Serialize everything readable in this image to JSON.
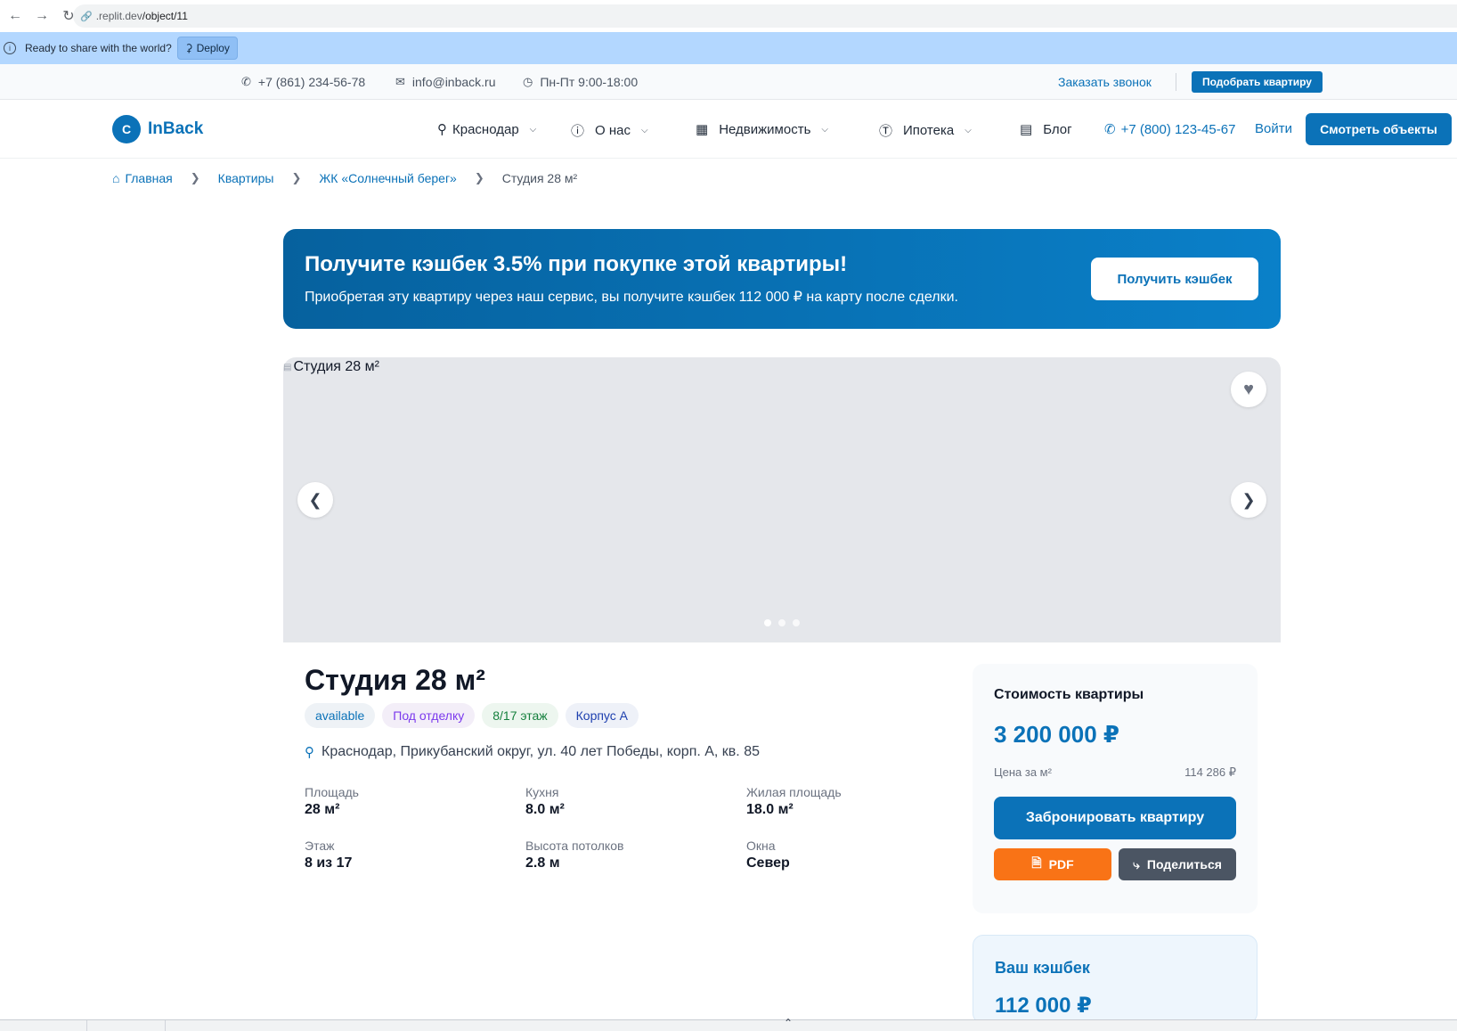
{
  "browser": {
    "url_host": ".replit.dev",
    "url_path": "/object/11"
  },
  "deploy_bar": {
    "message": "Ready to share with the world?",
    "button_label": "Deploy"
  },
  "topbar": {
    "phone": "+7 (861) 234-56-78",
    "email": "info@inback.ru",
    "hours": "Пн-Пт 9:00-18:00",
    "callback_link": "Заказать звонок",
    "pick_button": "Подобрать квартиру"
  },
  "nav": {
    "logo_letter": "С",
    "logo_text": "InBack",
    "city": "Краснодар",
    "about": "О нас",
    "realty": "Недвижимость",
    "mortgage": "Ипотека",
    "blog": "Блог",
    "phone": "+7 (800) 123-45-67",
    "login": "Войти",
    "cta": "Смотреть объекты"
  },
  "breadcrumb": {
    "home": "Главная",
    "apartments": "Квартиры",
    "complex": "ЖК «Солнечный берег»",
    "current": "Студия 28 м²"
  },
  "banner": {
    "title": "Получите кэшбек 3.5% при покупке этой квартиры!",
    "description": "Приобретая эту квартиру через наш сервис, вы получите кэшбек 112 000 ₽ на карту после сделки.",
    "button": "Получить кэшбек"
  },
  "gallery": {
    "image_alt": "Студия 28 м²",
    "dots_count": 3,
    "active_dot": 0
  },
  "object": {
    "title": "Студия 28 м²",
    "tags": [
      "available",
      "Под отделку",
      "8/17 этаж",
      "Корпус А"
    ],
    "address": "Краснодар, Прикубанский округ, ул. 40 лет Победы, корп. А, кв. 85",
    "specs": [
      {
        "label": "Площадь",
        "value": "28 м²"
      },
      {
        "label": "Кухня",
        "value": "8.0 м²"
      },
      {
        "label": "Жилая площадь",
        "value": "18.0 м²"
      },
      {
        "label": "Этаж",
        "value": "8 из 17"
      },
      {
        "label": "Высота потолков",
        "value": "2.8 м"
      },
      {
        "label": "Окна",
        "value": "Север"
      }
    ]
  },
  "price_card": {
    "title": "Стоимость квартиры",
    "price": "3 200 000 ₽",
    "per_sqm_label": "Цена за м²",
    "per_sqm_value": "114 286 ₽",
    "book_button": "Забронировать квартиру",
    "pdf_button": "PDF",
    "share_button": "Поделиться"
  },
  "cashback_card": {
    "title": "Ваш кэшбек",
    "value": "112 000 ₽"
  },
  "colors": {
    "brand": "#0b72b8",
    "pdf": "#f97316",
    "share": "#4b5563",
    "deploy_bar": "#b3d7ff"
  }
}
